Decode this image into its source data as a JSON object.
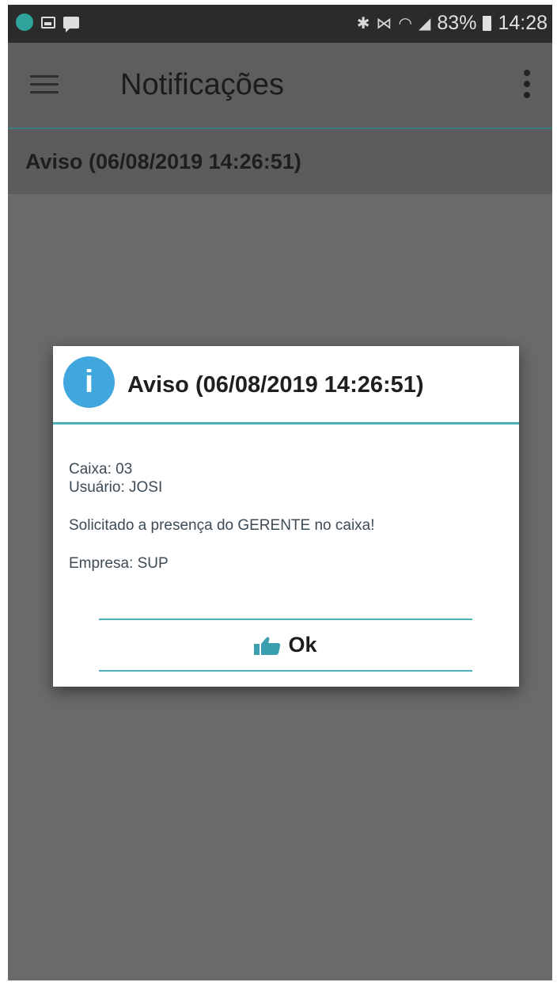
{
  "status_bar": {
    "icons_left": [
      "app-notification-icon",
      "image-icon",
      "chat-icon"
    ],
    "icons_right": [
      "bluetooth-icon",
      "mute-icon",
      "wifi-icon",
      "signal-icon"
    ],
    "battery": "83%",
    "time": "14:28"
  },
  "app_bar": {
    "title": "Notificações"
  },
  "list": {
    "items": [
      {
        "label": "Aviso (06/08/2019 14:26:51)"
      }
    ]
  },
  "dialog": {
    "title": "Aviso (06/08/2019 14:26:51)",
    "lines": {
      "caixa": "Caixa: 03",
      "usuario": "Usuário: JOSI",
      "message": "Solicitado a presença do GERENTE no caixa!",
      "empresa": "Empresa: SUP"
    },
    "ok_label": "Ok"
  },
  "colors": {
    "accent": "#4db0b8",
    "info_icon": "#3fa7dd",
    "thumb_icon": "#3aa0b0",
    "overlay": "#6a6a6a"
  }
}
